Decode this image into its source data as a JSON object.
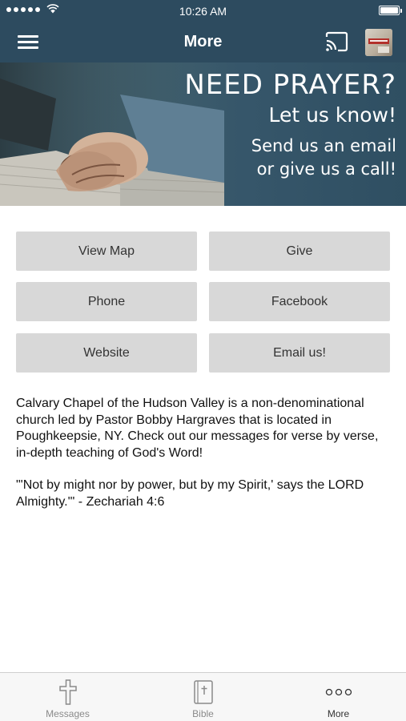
{
  "status_bar": {
    "time": "10:26 AM",
    "battery_level": 1.0
  },
  "nav_bar": {
    "title": "More"
  },
  "banner": {
    "headline": "NEED PRAYER?",
    "subhead": "Let us know!",
    "line1": "Send us an email",
    "line2": "or give us a call!"
  },
  "buttons": {
    "view_map": "View Map",
    "give": "Give",
    "phone": "Phone",
    "facebook": "Facebook",
    "website": "Website",
    "email": "Email us!"
  },
  "description": {
    "paragraph1": "Calvary Chapel of the Hudson Valley is a non-denominational church led by Pastor Bobby Hargraves that is located in Poughkeepsie, NY. Check out our messages for verse by verse, in-depth teaching of God's Word!",
    "paragraph2": "\"'Not by might nor by power, but by my Spirit,' says the LORD Almighty.'\" - Zechariah 4:6"
  },
  "tab_bar": {
    "tabs": [
      {
        "label": "Messages",
        "icon": "cross-icon"
      },
      {
        "label": "Bible",
        "icon": "bible-icon"
      },
      {
        "label": "More",
        "icon": "more-dots-icon",
        "active": true
      }
    ]
  },
  "colors": {
    "header": "#2d4b5f",
    "button": "#d8d8d8",
    "tab_bar": "#f7f7f7"
  }
}
